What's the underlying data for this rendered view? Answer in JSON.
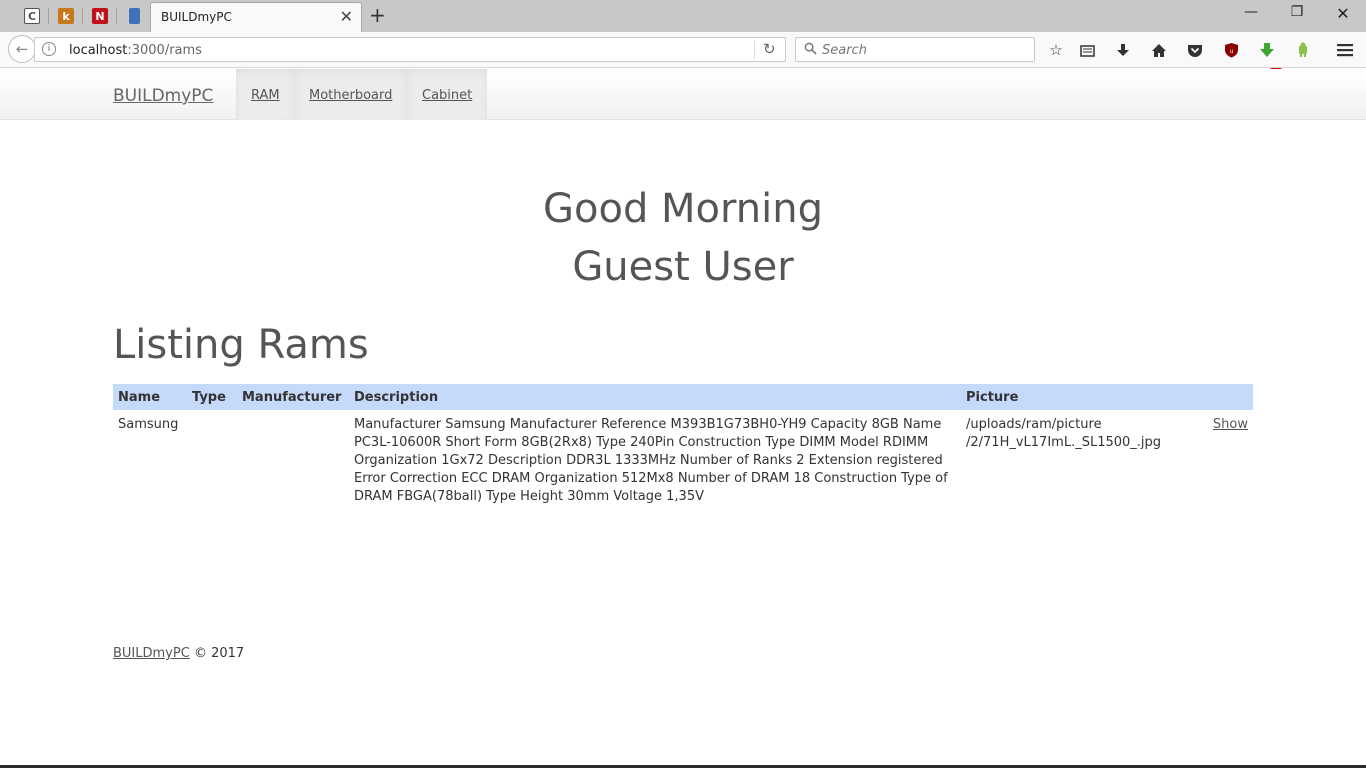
{
  "browser": {
    "active_tab_title": "BUILDmyPC",
    "pinned_tabs": [
      {
        "icon": "c-terminal-icon",
        "glyph": "C",
        "color": "#555555"
      },
      {
        "icon": "k-app-icon",
        "glyph": "k",
        "color": "#c8781c"
      },
      {
        "icon": "n-app-icon",
        "glyph": "N",
        "color": "#c0121b"
      },
      {
        "icon": "book-app-icon",
        "glyph": "",
        "color": "#3f72b8"
      }
    ],
    "url_host": "localhost",
    "url_rest": ":3000/rams",
    "search_placeholder": "Search",
    "badge_count": "?"
  },
  "site": {
    "brand": "BUILDmyPC",
    "nav": [
      {
        "label": "RAM"
      },
      {
        "label": "Motherboard"
      },
      {
        "label": "Cabinet"
      }
    ]
  },
  "greeting": {
    "line1": "Good Morning",
    "line2": "Guest User"
  },
  "page": {
    "heading": "Listing Rams"
  },
  "table": {
    "headers": {
      "name": "Name",
      "type": "Type",
      "manufacturer": "Manufacturer",
      "description": "Description",
      "picture": "Picture"
    },
    "rows": [
      {
        "name": "Samsung",
        "type": "",
        "manufacturer": "",
        "description": "Manufacturer Samsung Manufacturer Reference M393B1G73BH0-YH9 Capacity 8GB Name PC3L-10600R Short Form 8GB(2Rx8) Type 240Pin Construction Type DIMM Model RDIMM Organization 1Gx72 Description DDR3L 1333MHz Number of Ranks 2 Extension registered Error Correction ECC DRAM Organization 512Mx8 Number of DRAM 18 Construction Type of DRAM FBGA(78ball) Type Height 30mm Voltage 1,35V",
        "picture": "/uploads/ram/picture /2/71H_vL17ImL._SL1500_.jpg",
        "action": "Show"
      }
    ]
  },
  "footer": {
    "brand": "BUILDmyPC",
    "copy": "© 2017"
  }
}
